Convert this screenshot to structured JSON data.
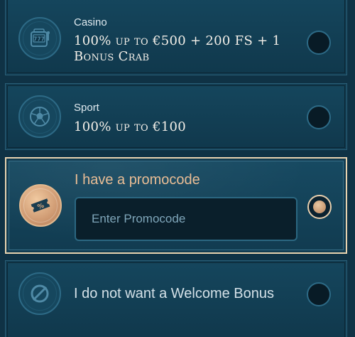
{
  "bonus_options": [
    {
      "category": "Casino",
      "headline": "100% up to €500 + 200 FS + 1 Bonus Crab",
      "icon": "slot-machine-icon",
      "selected": false
    },
    {
      "category": "Sport",
      "headline": "100% up to €100",
      "icon": "soccer-ball-icon",
      "selected": false
    }
  ],
  "promocode": {
    "label": "I have a promocode",
    "placeholder": "Enter Promocode",
    "value": "",
    "icon": "ticket-icon",
    "selected": true
  },
  "no_bonus": {
    "label": "I do not want a Welcome Bonus",
    "icon": "no-symbol-icon",
    "selected": false
  },
  "colors": {
    "background": "#0f3245",
    "card": "#15465d",
    "accent_gold": "#e8cfae",
    "promo_label": "#e9bd95"
  }
}
